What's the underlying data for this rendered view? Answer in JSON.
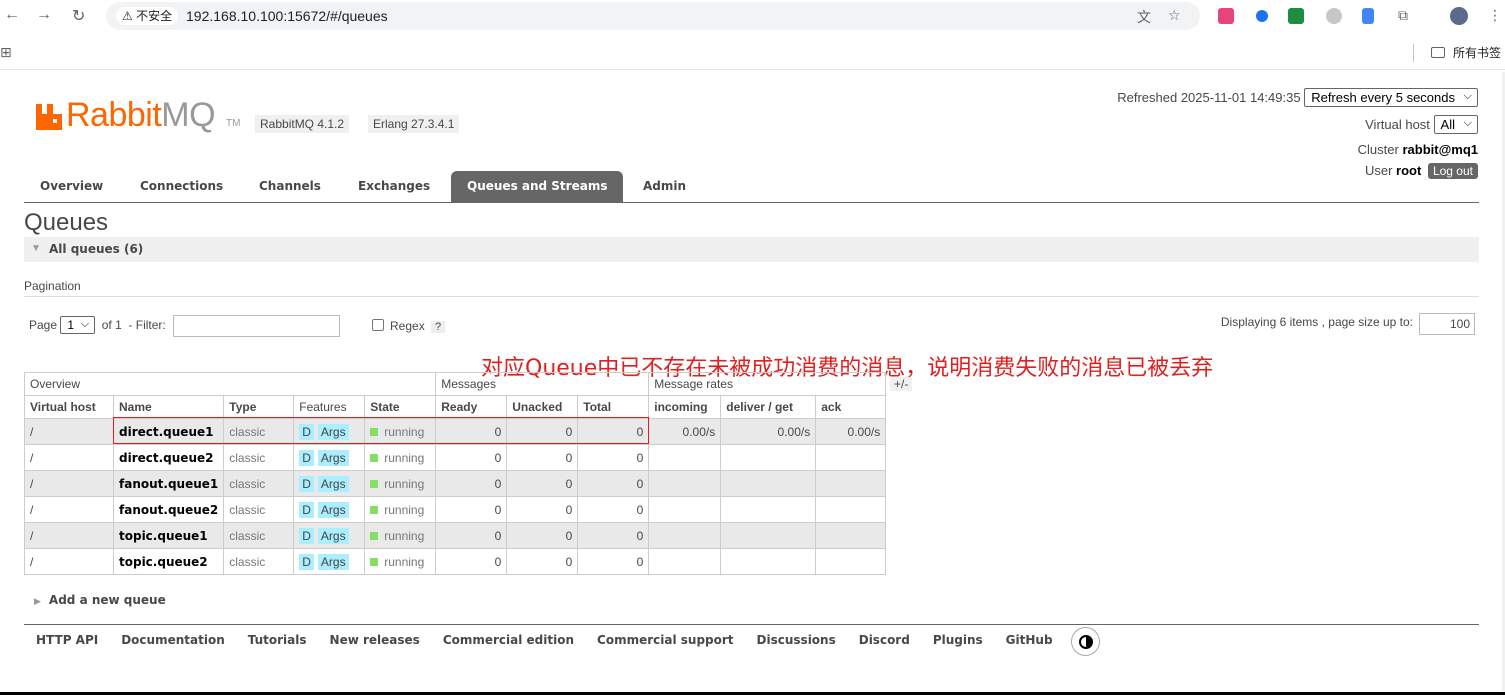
{
  "browser": {
    "security_label": "⚠ 不安全",
    "url": "192.168.10.100:15672/#/queues",
    "all_bookmarks": "所有书签"
  },
  "brand": {
    "logo_main": "Rabbit",
    "logo_mq": "MQ",
    "tm": "TM",
    "rabbitmq_version": "RabbitMQ 4.1.2",
    "erlang_version": "Erlang 27.3.4.1"
  },
  "status": {
    "refreshed": "Refreshed 2025-11-01 14:49:35",
    "refresh_option": "Refresh every 5 seconds",
    "virtual_host_label": "Virtual host",
    "virtual_host_value": "All",
    "cluster_label": "Cluster",
    "cluster_value": "rabbit@mq1",
    "user_label": "User",
    "user_value": "root",
    "logout": "Log out"
  },
  "tabs": [
    "Overview",
    "Connections",
    "Channels",
    "Exchanges",
    "Queues and Streams",
    "Admin"
  ],
  "page": {
    "title": "Queues",
    "section": "All queues (6)",
    "pagination_heading": "Pagination",
    "page_label": "Page",
    "page_value": "1",
    "of_label": "of 1",
    "filter_label": "- Filter:",
    "regex_label": "Regex",
    "help": "?",
    "displaying": "Displaying 6 items , page size up to:",
    "page_size": "100",
    "annotation": "对应Queue中已不存在未被成功消费的消息，说明消费失败的消息已被丢弃"
  },
  "table": {
    "groups": [
      "Overview",
      "Messages",
      "Message rates"
    ],
    "plus_minus": "+/-",
    "headers": [
      "Virtual host",
      "Name",
      "Type",
      "Features",
      "State",
      "Ready",
      "Unacked",
      "Total",
      "incoming",
      "deliver / get",
      "ack"
    ],
    "rows": [
      {
        "vhost": "/",
        "name": "direct.queue1",
        "type": "classic",
        "feat_d": "D",
        "feat_args": "Args",
        "state": "running",
        "ready": "0",
        "unacked": "0",
        "total": "0",
        "incoming": "0.00/s",
        "deliver": "0.00/s",
        "ack": "0.00/s"
      },
      {
        "vhost": "/",
        "name": "direct.queue2",
        "type": "classic",
        "feat_d": "D",
        "feat_args": "Args",
        "state": "running",
        "ready": "0",
        "unacked": "0",
        "total": "0",
        "incoming": "",
        "deliver": "",
        "ack": ""
      },
      {
        "vhost": "/",
        "name": "fanout.queue1",
        "type": "classic",
        "feat_d": "D",
        "feat_args": "Args",
        "state": "running",
        "ready": "0",
        "unacked": "0",
        "total": "0",
        "incoming": "",
        "deliver": "",
        "ack": ""
      },
      {
        "vhost": "/",
        "name": "fanout.queue2",
        "type": "classic",
        "feat_d": "D",
        "feat_args": "Args",
        "state": "running",
        "ready": "0",
        "unacked": "0",
        "total": "0",
        "incoming": "",
        "deliver": "",
        "ack": ""
      },
      {
        "vhost": "/",
        "name": "topic.queue1",
        "type": "classic",
        "feat_d": "D",
        "feat_args": "Args",
        "state": "running",
        "ready": "0",
        "unacked": "0",
        "total": "0",
        "incoming": "",
        "deliver": "",
        "ack": ""
      },
      {
        "vhost": "/",
        "name": "topic.queue2",
        "type": "classic",
        "feat_d": "D",
        "feat_args": "Args",
        "state": "running",
        "ready": "0",
        "unacked": "0",
        "total": "0",
        "incoming": "",
        "deliver": "",
        "ack": ""
      }
    ]
  },
  "add_queue": "Add a new queue",
  "footer": [
    "HTTP API",
    "Documentation",
    "Tutorials",
    "New releases",
    "Commercial edition",
    "Commercial support",
    "Discussions",
    "Discord",
    "Plugins",
    "GitHub"
  ],
  "colors": {
    "brand_orange": "#ff6600",
    "tab_active": "#666666",
    "annotation_red": "#e02020",
    "running_green": "#88dd66",
    "feature_tag": "#aaeeff"
  }
}
